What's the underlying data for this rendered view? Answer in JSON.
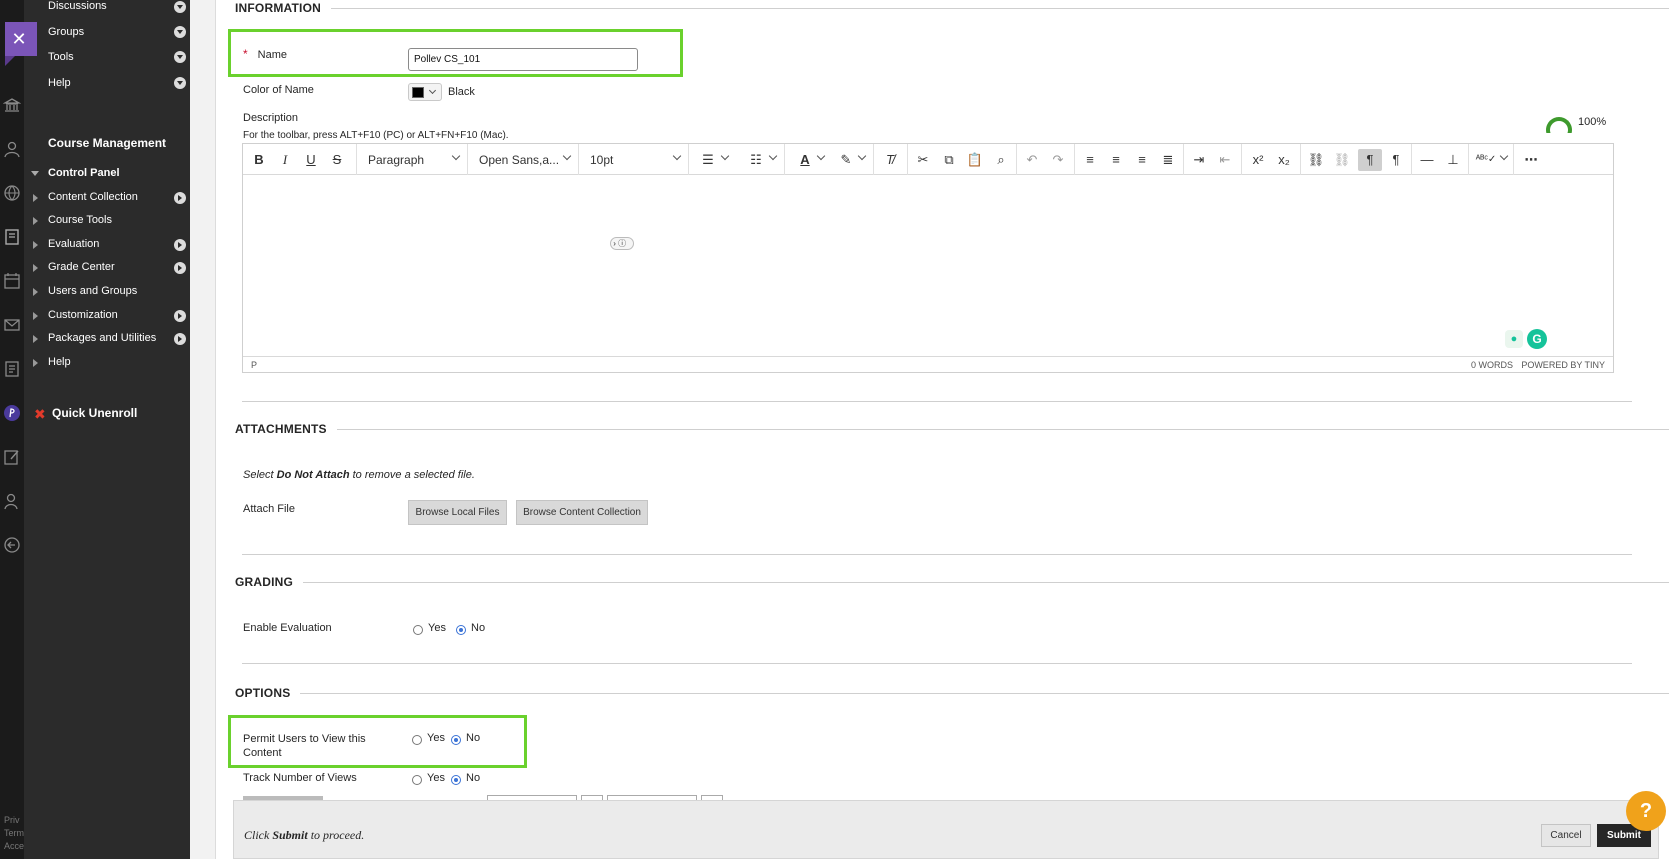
{
  "rail": {
    "icons": [
      "close-icon",
      "institution-icon",
      "profile-icon",
      "globe-icon",
      "courses-icon",
      "calendar-icon",
      "messages-icon",
      "grades-icon",
      "pollev-icon",
      "edit-icon",
      "user-icon",
      "logout-icon"
    ],
    "accent_color": "#7b55b8",
    "footer_lines": [
      "Priv",
      "Term",
      "Acce"
    ]
  },
  "course_menu": {
    "top_items": [
      {
        "label": "Discussions"
      },
      {
        "label": "Groups"
      },
      {
        "label": "Tools"
      },
      {
        "label": "Help"
      }
    ],
    "management_title": "Course Management",
    "control_panel_label": "Control Panel",
    "control_panel_items": [
      {
        "label": "Content Collection",
        "has_arrow": true
      },
      {
        "label": "Course Tools",
        "has_arrow": false
      },
      {
        "label": "Evaluation",
        "has_arrow": true
      },
      {
        "label": "Grade Center",
        "has_arrow": true
      },
      {
        "label": "Users and Groups",
        "has_arrow": false
      },
      {
        "label": "Customization",
        "has_arrow": true
      },
      {
        "label": "Packages and Utilities",
        "has_arrow": true
      },
      {
        "label": "Help",
        "has_arrow": false
      }
    ],
    "quick_unenroll_label": "Quick Unenroll"
  },
  "information": {
    "section_title": "INFORMATION",
    "name_label": "Name",
    "name_required_mark": "*",
    "name_value": "Pollev CS_101",
    "color_label": "Color of Name",
    "color_value_text": "Black",
    "color_swatch": "#000000",
    "description_label": "Description",
    "description_hint": "For the toolbar, press ALT+F10 (PC) or ALT+FN+F10 (Mac).",
    "progress_percent": 100,
    "progress_label": "100%",
    "progress_color": "#3e9a2d"
  },
  "editor": {
    "block_format": "Paragraph",
    "font_family": "Open Sans,a...",
    "font_size": "10pt",
    "status_path": "P",
    "word_count": "0 WORDS",
    "powered_by": "POWERED BY TINY"
  },
  "attachments": {
    "section_title": "ATTACHMENTS",
    "hint_prefix": "Select ",
    "hint_bold": "Do Not Attach",
    "hint_suffix": " to remove a selected file.",
    "attach_label": "Attach File",
    "browse_local": "Browse Local Files",
    "browse_collection": "Browse Content Collection"
  },
  "grading": {
    "section_title": "GRADING",
    "enable_label": "Enable Evaluation",
    "yes": "Yes",
    "no": "No",
    "selected": "No"
  },
  "options": {
    "section_title": "OPTIONS",
    "permit_label_line1": "Permit Users to View this",
    "permit_label_line2": "Content",
    "permit_yes": "Yes",
    "permit_no": "No",
    "permit_selected": "No",
    "track_label": "Track Number of Views",
    "track_yes": "Yes",
    "track_no": "No",
    "track_selected": "No"
  },
  "submit_bar": {
    "hint_prefix": "Click ",
    "hint_bold": "Submit",
    "hint_suffix": " to proceed.",
    "cancel": "Cancel",
    "submit": "Submit"
  },
  "highlight_color": "#6ad12d",
  "help_bubble_color": "#f0a21b"
}
